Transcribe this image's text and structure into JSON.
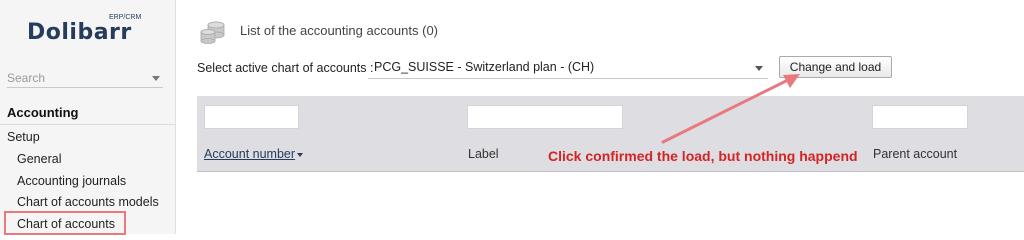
{
  "logo": {
    "name": "Dolibarr",
    "tagline": "ERP/CRM"
  },
  "sidebar": {
    "search_placeholder": "Search",
    "section": "Accounting",
    "group": "Setup",
    "items": [
      {
        "label": "General"
      },
      {
        "label": "Accounting journals"
      },
      {
        "label": "Chart of accounts models"
      },
      {
        "label": "Chart of accounts"
      }
    ]
  },
  "main": {
    "title": "List of the accounting accounts (0)",
    "select_label": "Select active chart of accounts :",
    "select_value": "PCG_SUISSE - Switzerland plan - (CH)",
    "button_label": "Change and load",
    "columns": {
      "account_number": "Account number",
      "label": "Label",
      "parent_account": "Parent account"
    }
  },
  "annotation": {
    "text": "Click confirmed the load, but nothing happend",
    "color": "#d42424",
    "highlight_color": "#e8797f"
  }
}
